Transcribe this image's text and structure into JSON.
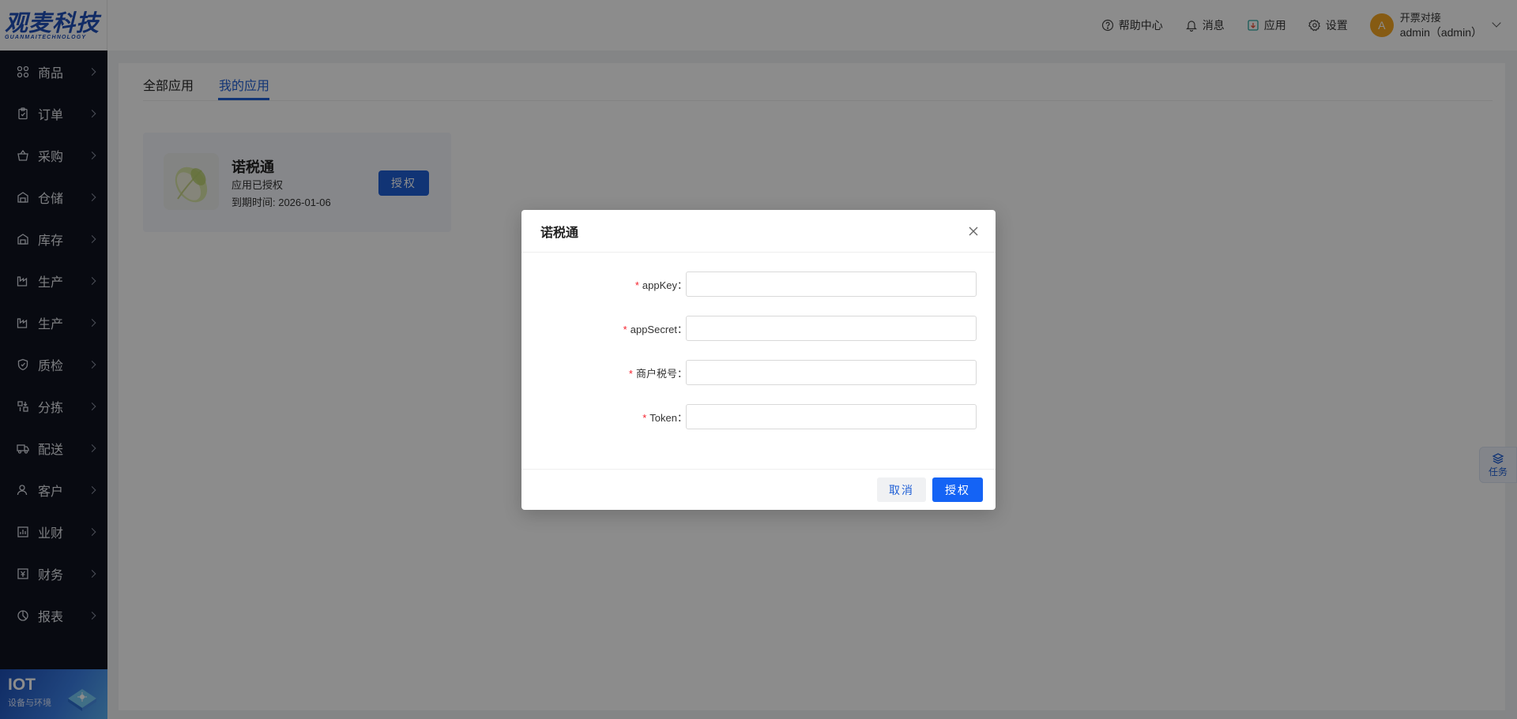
{
  "brand": {
    "logo_text": "观麦科技",
    "logo_sub": "GUANMAITECHNOLOGY",
    "color": "#1f4fb8"
  },
  "sidebar": {
    "items": [
      {
        "label": "商品",
        "icon": "grid-icon"
      },
      {
        "label": "订单",
        "icon": "clipboard-icon"
      },
      {
        "label": "采购",
        "icon": "basket-icon"
      },
      {
        "label": "仓储",
        "icon": "warehouse-icon"
      },
      {
        "label": "库存",
        "icon": "warehouse-icon"
      },
      {
        "label": "生产",
        "icon": "factory-icon"
      },
      {
        "label": "生产",
        "icon": "factory-icon"
      },
      {
        "label": "质检",
        "icon": "shield-icon"
      },
      {
        "label": "分拣",
        "icon": "sort-icon"
      },
      {
        "label": "配送",
        "icon": "truck-icon"
      },
      {
        "label": "客户",
        "icon": "user-icon"
      },
      {
        "label": "业财",
        "icon": "bar-chart-icon"
      },
      {
        "label": "财务",
        "icon": "finance-icon"
      },
      {
        "label": "报表",
        "icon": "pie-icon"
      }
    ],
    "iot": {
      "title": "IOT",
      "subtitle": "设备与环境"
    }
  },
  "header": {
    "help": "帮助中心",
    "messages": "消息",
    "apps": "应用",
    "settings": "设置",
    "user": {
      "avatar_letter": "A",
      "line1": "开票对接",
      "line2": "admin（admin）"
    }
  },
  "tabs": {
    "all": "全部应用",
    "mine": "我的应用"
  },
  "app_card": {
    "name": "诺税通",
    "status": "应用已授权",
    "expire": "到期时间: 2026-01-06",
    "button": "授权"
  },
  "task_float": {
    "label": "任务"
  },
  "modal": {
    "title": "诺税通",
    "fields": [
      {
        "label": "appKey：",
        "value": "",
        "required": "*"
      },
      {
        "label": "appSecret：",
        "value": "",
        "required": "*"
      },
      {
        "label": "商户税号：",
        "value": "",
        "required": "*"
      },
      {
        "label": "Token：",
        "value": "",
        "required": "*"
      }
    ],
    "cancel": "取消",
    "ok": "授权"
  },
  "colors": {
    "primary": "#1463f5",
    "sidebar_bg": "#0f1320",
    "required": "#f5222d",
    "avatar": "#f5a623"
  }
}
